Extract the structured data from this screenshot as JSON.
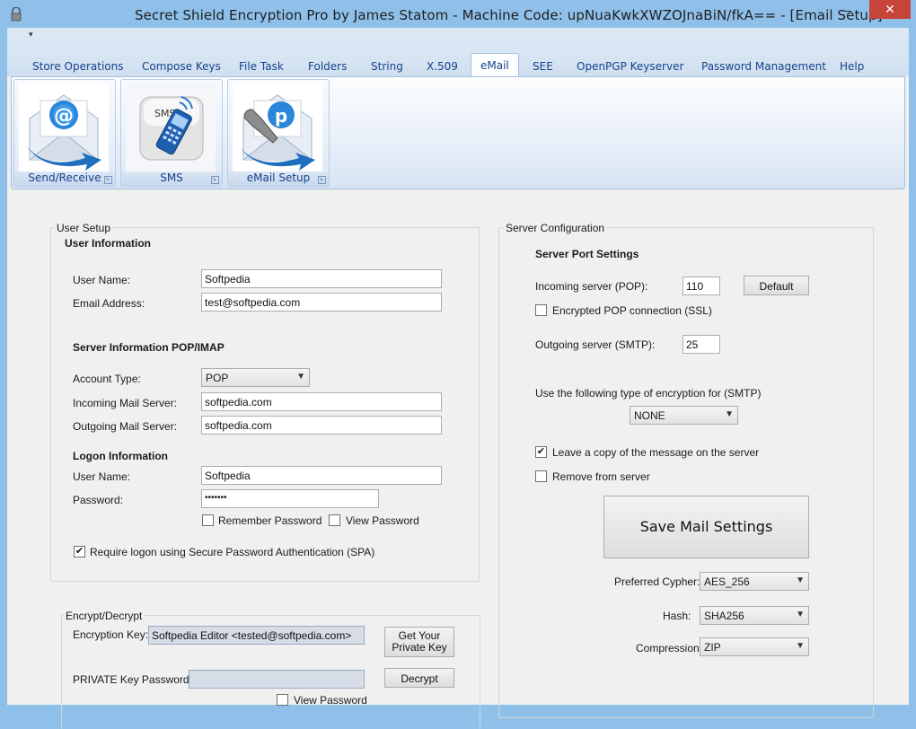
{
  "window": {
    "title": "Secret Shield Encryption Pro by James Statom - Machine Code: upNuaKwkXWZOJnaBiN/fkA== - [Email Setup]",
    "minimize_icon": "minimize-icon",
    "close_icon": "close-icon",
    "close_glyph": "✕",
    "minimize_glyph": "–"
  },
  "qat": {
    "dropdown_glyph": "▾"
  },
  "tabs": [
    {
      "label": "Store Operations"
    },
    {
      "label": "Compose Keys"
    },
    {
      "label": "File Task"
    },
    {
      "label": "Folders"
    },
    {
      "label": "String"
    },
    {
      "label": "X.509"
    },
    {
      "label": "eMail"
    },
    {
      "label": "SEE"
    },
    {
      "label": "OpenPGP Keyserver"
    },
    {
      "label": "Password Management"
    },
    {
      "label": "Help"
    }
  ],
  "active_tab": "eMail",
  "ribbon": {
    "groups": [
      {
        "label": "Send/Receive",
        "icon": "envelope-at-icon"
      },
      {
        "label": "SMS",
        "icon": "sms-phone-icon"
      },
      {
        "label": "eMail Setup",
        "icon": "envelope-settings-icon"
      }
    ]
  },
  "user_setup": {
    "title": "User Setup",
    "user_information": "User Information",
    "user_name_label": "User Name:",
    "user_name_value": "Softpedia",
    "email_label": "Email Address:",
    "email_value": "test@softpedia.com",
    "server_info_header": "Server Information POP/IMAP",
    "account_type_label": "Account Type:",
    "account_type_value": "POP",
    "incoming_label": "Incoming Mail Server:",
    "incoming_value": "softpedia.com",
    "outgoing_label": "Outgoing Mail Server:",
    "outgoing_value": "softpedia.com",
    "logon_header": "Logon Information",
    "logon_user_label": "User Name:",
    "logon_user_value": "Softpedia",
    "password_label": "Password:",
    "password_value": "•••••••",
    "remember_password": "Remember Password",
    "remember_checked": false,
    "view_password": "View Password",
    "view_checked": false,
    "spa_label": "Require logon using Secure Password Authentication (SPA)",
    "spa_checked": true
  },
  "encrypt": {
    "title": "Encrypt/Decrypt",
    "key_label": "Encryption Key:",
    "key_value": "Softpedia Editor <tested@softpedia.com>",
    "get_key_button": "Get Your Private Key",
    "private_password_label": "PRIVATE Key Password:",
    "private_password_value": "",
    "decrypt_button": "Decrypt",
    "view_password": "View Password",
    "view_checked": false
  },
  "server": {
    "title": "Server Configuration",
    "port_header": "Server Port Settings",
    "incoming_label": "Incoming server (POP):",
    "incoming_port": "110",
    "default_button": "Default",
    "ssl_label": "Encrypted POP connection (SSL)",
    "ssl_checked": false,
    "outgoing_label": "Outgoing server (SMTP):",
    "outgoing_port": "25",
    "encryption_type_label": "Use the following type of encryption for (SMTP)",
    "encryption_type_value": "NONE",
    "leave_copy_label": "Leave a copy of the message on the server",
    "leave_copy_checked": true,
    "remove_label": "Remove from server",
    "remove_checked": false,
    "save_button": "Save Mail Settings",
    "cypher_label": "Preferred  Cypher:",
    "cypher_value": "AES_256",
    "hash_label": "Hash:",
    "hash_value": "SHA256",
    "compression_label": "Compression",
    "compression_value": "ZIP"
  },
  "glyphs": {
    "check": "✔",
    "dropdown": "▼",
    "launcher": "↘"
  },
  "colors": {
    "title_bar": "#8fc0ea",
    "tab_text": "#15428b",
    "close_button": "#c7443a",
    "ribbon_border": "#a7bedb"
  }
}
